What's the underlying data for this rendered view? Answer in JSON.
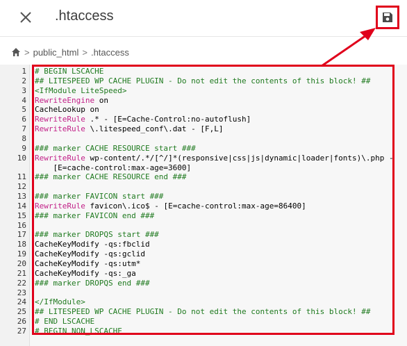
{
  "header": {
    "title": ".htaccess",
    "close_icon": "close-icon",
    "save_icon": "save-icon"
  },
  "breadcrumb": {
    "home_icon": "home-icon",
    "items": [
      "public_html",
      ".htaccess"
    ],
    "separator": ">"
  },
  "editor": {
    "lines": [
      {
        "n": "1",
        "parts": [
          {
            "t": "# BEGIN LSCACHE",
            "c": "comment"
          }
        ]
      },
      {
        "n": "2",
        "parts": [
          {
            "t": "## LITESPEED WP CACHE PLUGIN - Do not edit the contents of this block! ##",
            "c": "comment"
          }
        ]
      },
      {
        "n": "3",
        "parts": [
          {
            "t": "<IfModule LiteSpeed>",
            "c": "tag"
          }
        ]
      },
      {
        "n": "4",
        "parts": [
          {
            "t": "RewriteEngine",
            "c": "kw"
          },
          {
            "t": " on",
            "c": "plain"
          }
        ]
      },
      {
        "n": "5",
        "parts": [
          {
            "t": "CacheLookup on",
            "c": "plain"
          }
        ]
      },
      {
        "n": "6",
        "parts": [
          {
            "t": "RewriteRule",
            "c": "kw"
          },
          {
            "t": " .* - [E=Cache-Control:no-autoflush]",
            "c": "plain"
          }
        ]
      },
      {
        "n": "7",
        "parts": [
          {
            "t": "RewriteRule",
            "c": "kw"
          },
          {
            "t": " \\.litespeed_conf\\.dat - [F,L]",
            "c": "plain"
          }
        ]
      },
      {
        "n": "8",
        "parts": [
          {
            "t": "",
            "c": "plain"
          }
        ]
      },
      {
        "n": "9",
        "parts": [
          {
            "t": "### marker CACHE RESOURCE start ###",
            "c": "comment"
          }
        ]
      },
      {
        "n": "10",
        "parts": [
          {
            "t": "RewriteRule",
            "c": "kw"
          },
          {
            "t": " wp-content/.*/[^/]*(responsive|css|js|dynamic|loader|fonts)\\.php -",
            "c": "plain"
          }
        ]
      },
      {
        "n": "",
        "parts": [
          {
            "t": "    [E=cache-control:max-age=3600]",
            "c": "plain"
          }
        ]
      },
      {
        "n": "11",
        "parts": [
          {
            "t": "### marker CACHE RESOURCE end ###",
            "c": "comment"
          }
        ]
      },
      {
        "n": "12",
        "parts": [
          {
            "t": "",
            "c": "plain"
          }
        ]
      },
      {
        "n": "13",
        "parts": [
          {
            "t": "### marker FAVICON start ###",
            "c": "comment"
          }
        ]
      },
      {
        "n": "14",
        "parts": [
          {
            "t": "RewriteRule",
            "c": "kw"
          },
          {
            "t": " favicon\\.ico$ - [E=cache-control:max-age=86400]",
            "c": "plain"
          }
        ]
      },
      {
        "n": "15",
        "parts": [
          {
            "t": "### marker FAVICON end ###",
            "c": "comment"
          }
        ]
      },
      {
        "n": "16",
        "parts": [
          {
            "t": "",
            "c": "plain"
          }
        ]
      },
      {
        "n": "17",
        "parts": [
          {
            "t": "### marker DROPQS start ###",
            "c": "comment"
          }
        ]
      },
      {
        "n": "18",
        "parts": [
          {
            "t": "CacheKeyModify -qs:fbclid",
            "c": "plain"
          }
        ]
      },
      {
        "n": "19",
        "parts": [
          {
            "t": "CacheKeyModify -qs:gclid",
            "c": "plain"
          }
        ]
      },
      {
        "n": "20",
        "parts": [
          {
            "t": "CacheKeyModify -qs:utm*",
            "c": "plain"
          }
        ]
      },
      {
        "n": "21",
        "parts": [
          {
            "t": "CacheKeyModify -qs:_ga",
            "c": "plain"
          }
        ]
      },
      {
        "n": "22",
        "parts": [
          {
            "t": "### marker DROPQS end ###",
            "c": "comment"
          }
        ]
      },
      {
        "n": "23",
        "parts": [
          {
            "t": "",
            "c": "plain"
          }
        ]
      },
      {
        "n": "24",
        "parts": [
          {
            "t": "</IfModule>",
            "c": "tag"
          }
        ]
      },
      {
        "n": "25",
        "parts": [
          {
            "t": "## LITESPEED WP CACHE PLUGIN - Do not edit the contents of this block! ##",
            "c": "comment"
          }
        ]
      },
      {
        "n": "26",
        "parts": [
          {
            "t": "# END LSCACHE",
            "c": "comment"
          }
        ]
      },
      {
        "n": "27",
        "parts": [
          {
            "t": "# BEGIN NON_LSCACHE",
            "c": "comment"
          }
        ]
      }
    ]
  },
  "colors": {
    "annotation": "#e0001b",
    "comment": "#1f7a1f",
    "keyword": "#c11f87"
  }
}
